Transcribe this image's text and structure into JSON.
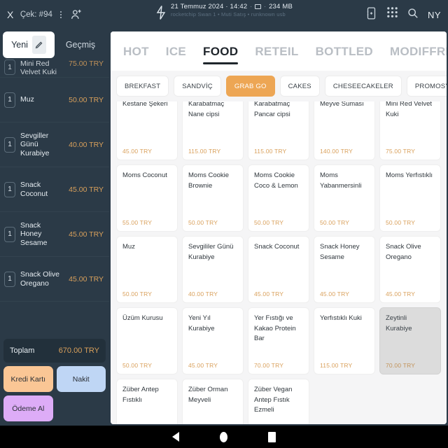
{
  "topbar": {
    "close_label": "X",
    "check_label": "Çek: #94",
    "datetime": "21 Temmuz 2024 · 14:42",
    "memory": "234 MB",
    "subtitle": "rocketchip Swan 1 • Muti Satış • runknown usb",
    "avatar_initials": "NY"
  },
  "sidebar": {
    "tabs": {
      "new_label": "Yeni",
      "history_label": "Geçmiş"
    },
    "cart": [
      {
        "qty": "1",
        "name": "Mini Red Velvet Kuki",
        "price": "75.00 TRY"
      },
      {
        "qty": "1",
        "name": "Muz",
        "price": "50.00 TRY"
      },
      {
        "qty": "1",
        "name": "Sevgiller Günü Kurabiye",
        "price": "40.00 TRY"
      },
      {
        "qty": "1",
        "name": "Snack Coconut",
        "price": "45.00 TRY"
      },
      {
        "qty": "1",
        "name": "Snack Honey Sesame",
        "price": "45.00 TRY"
      },
      {
        "qty": "1",
        "name": "Snack Olive Oregano",
        "price": "45.00 TRY"
      }
    ],
    "total_label": "Toplam",
    "total_value": "670.00 TRY",
    "payments": [
      {
        "label": "Kredi Kartı",
        "color": "#fac695"
      },
      {
        "label": "Nakit",
        "color": "#bfd6f5"
      },
      {
        "label": "Ödeme Al",
        "color": "#ddacf7"
      }
    ]
  },
  "main": {
    "tabs": [
      {
        "label": "HOT",
        "active": false
      },
      {
        "label": "ICE",
        "active": false
      },
      {
        "label": "FOOD",
        "active": true
      },
      {
        "label": "RETEIL",
        "active": false
      },
      {
        "label": "BOTTLED",
        "active": false
      },
      {
        "label": "MODIFFRES",
        "active": false
      }
    ],
    "chips": [
      {
        "label": "BREKFAST",
        "active": false
      },
      {
        "label": "SANDVİÇ",
        "active": false
      },
      {
        "label": "GRAB GO",
        "active": true
      },
      {
        "label": "CAKES",
        "active": false
      },
      {
        "label": "CHESEECAKELER",
        "active": false
      },
      {
        "label": "PROMOSYON",
        "active": false
      }
    ],
    "products": [
      {
        "name": "Kestane Şekeri",
        "price": "45.00 TRY",
        "selected": false
      },
      {
        "name": "Karabatmaç Nane cipsi",
        "price": "115.00 TRY",
        "selected": false
      },
      {
        "name": "Karabatmaç Pancar cipsi",
        "price": "115.00 TRY",
        "selected": false
      },
      {
        "name": "Meyve Suması",
        "price": "140.00 TRY",
        "selected": false
      },
      {
        "name": "Mini Red Velvet Kuki",
        "price": "75.00 TRY",
        "selected": false
      },
      {
        "name": "Moms Coconut",
        "price": "55.00 TRY",
        "selected": false
      },
      {
        "name": "Moms Cookie Brownie",
        "price": "50.00 TRY",
        "selected": false
      },
      {
        "name": "Moms Cookie Coco & Lemon",
        "price": "50.00 TRY",
        "selected": false
      },
      {
        "name": "Moms Yabanmersinli",
        "price": "50.00 TRY",
        "selected": false
      },
      {
        "name": "Moms Yerfıstıklı",
        "price": "50.00 TRY",
        "selected": false
      },
      {
        "name": "Muz",
        "price": "50.00 TRY",
        "selected": false
      },
      {
        "name": "Sevgililer Günü Kurabiye",
        "price": "40.00 TRY",
        "selected": false
      },
      {
        "name": "Snack Coconut",
        "price": "45.00 TRY",
        "selected": false
      },
      {
        "name": "Snack Honey Sesame",
        "price": "45.00 TRY",
        "selected": false
      },
      {
        "name": "Snack Olive Oregano",
        "price": "45.00 TRY",
        "selected": false
      },
      {
        "name": "Üzüm Kurusu",
        "price": "50.00 TRY",
        "selected": false
      },
      {
        "name": "Yeni Yıl Kurabiye",
        "price": "45.00 TRY",
        "selected": false
      },
      {
        "name": "Yer Fıstığı ve Kakao Protein Bar",
        "price": "70.00 TRY",
        "selected": false
      },
      {
        "name": "Yerfıstıklı Kuki",
        "price": "115.00 TRY",
        "selected": false
      },
      {
        "name": "Zeytinli Kurabiye",
        "price": "70.00 TRY",
        "selected": true
      },
      {
        "name": "Züber Antep Fıstıklı",
        "price": "",
        "selected": false
      },
      {
        "name": "Züber Orman Meyveli",
        "price": "",
        "selected": false
      },
      {
        "name": "Züber Vegan Antep Fıstık Ezmeli",
        "price": "",
        "selected": false
      }
    ]
  },
  "colors": {
    "background": "#2b3a47",
    "accent_orange": "#eda654",
    "price_gold": "#d9a05b",
    "panel": "#ffffff"
  }
}
